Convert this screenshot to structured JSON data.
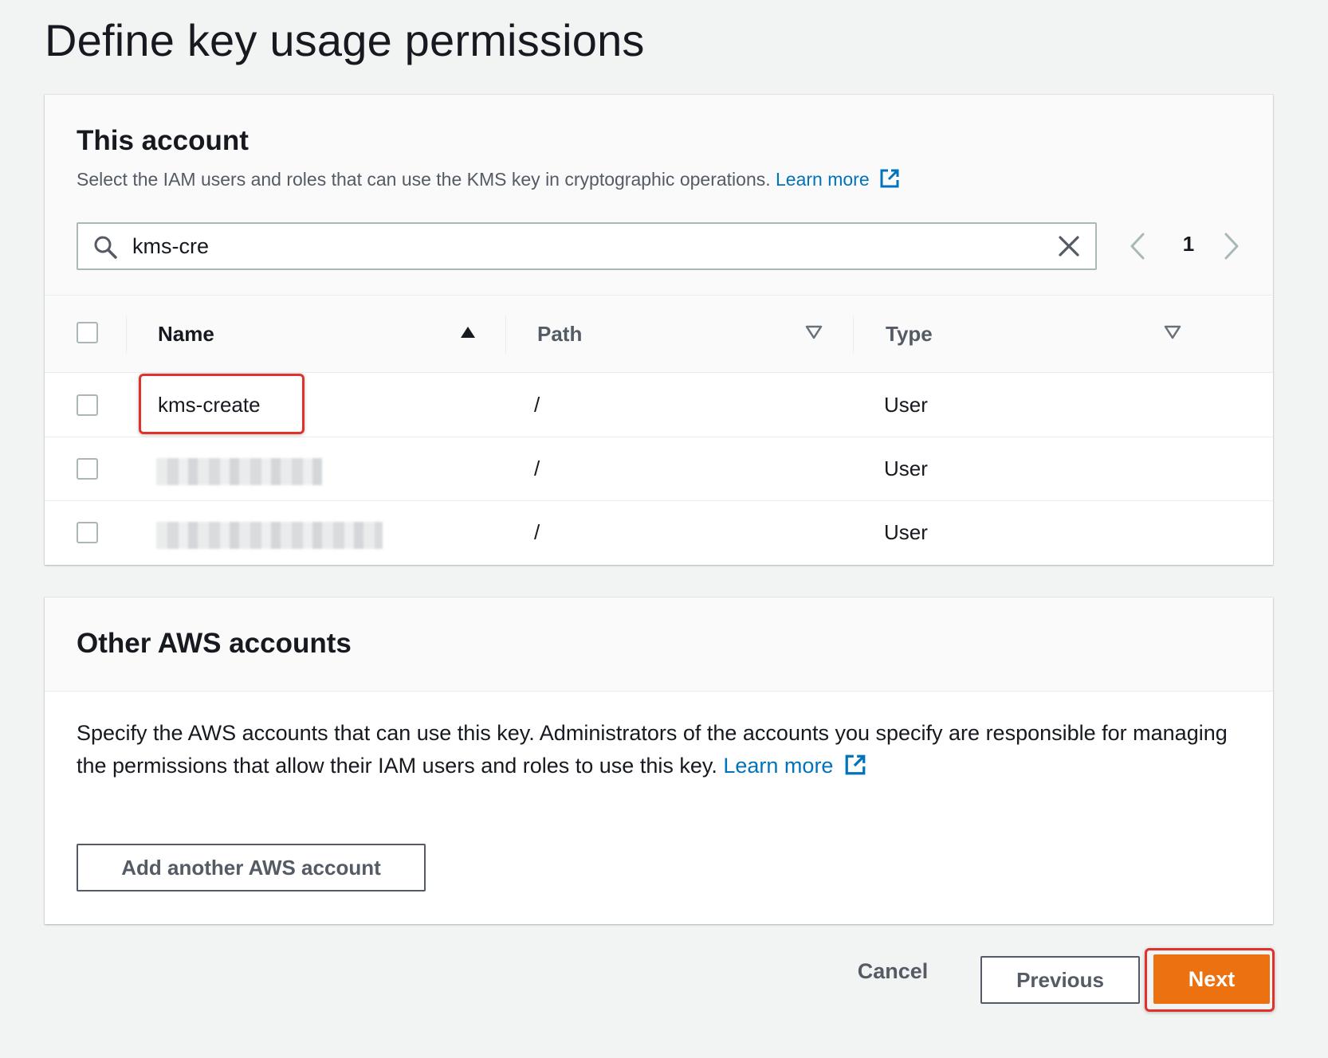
{
  "page": {
    "title": "Define key usage permissions"
  },
  "this_account": {
    "title": "This account",
    "description": "Select the IAM users and roles that can use the KMS key in cryptographic operations.",
    "learn_more": "Learn more",
    "search": {
      "value": "kms-cre"
    },
    "pagination": {
      "current_page": "1"
    },
    "table": {
      "columns": [
        {
          "label": "Name",
          "sort": "ascending"
        },
        {
          "label": "Path",
          "sort": "none"
        },
        {
          "label": "Type",
          "sort": "none"
        }
      ],
      "rows": [
        {
          "name": "kms-create",
          "path": "/",
          "type": "User",
          "name_obscured": false,
          "highlighted": true
        },
        {
          "name": "",
          "path": "/",
          "type": "User",
          "name_obscured": true,
          "highlighted": false
        },
        {
          "name": "",
          "path": "/",
          "type": "User",
          "name_obscured": true,
          "highlighted": false
        }
      ]
    }
  },
  "other_accounts": {
    "title": "Other AWS accounts",
    "description": "Specify the AWS accounts that can use this key. Administrators of the accounts you specify are responsible for managing the permissions that allow their IAM users and roles to use this key.",
    "learn_more": "Learn more",
    "add_button": "Add another AWS account"
  },
  "footer": {
    "cancel": "Cancel",
    "previous": "Previous",
    "next": "Next"
  },
  "colors": {
    "primary_button": "#ec7211",
    "link": "#0073bb",
    "highlight_annotation": "#e0312a"
  }
}
